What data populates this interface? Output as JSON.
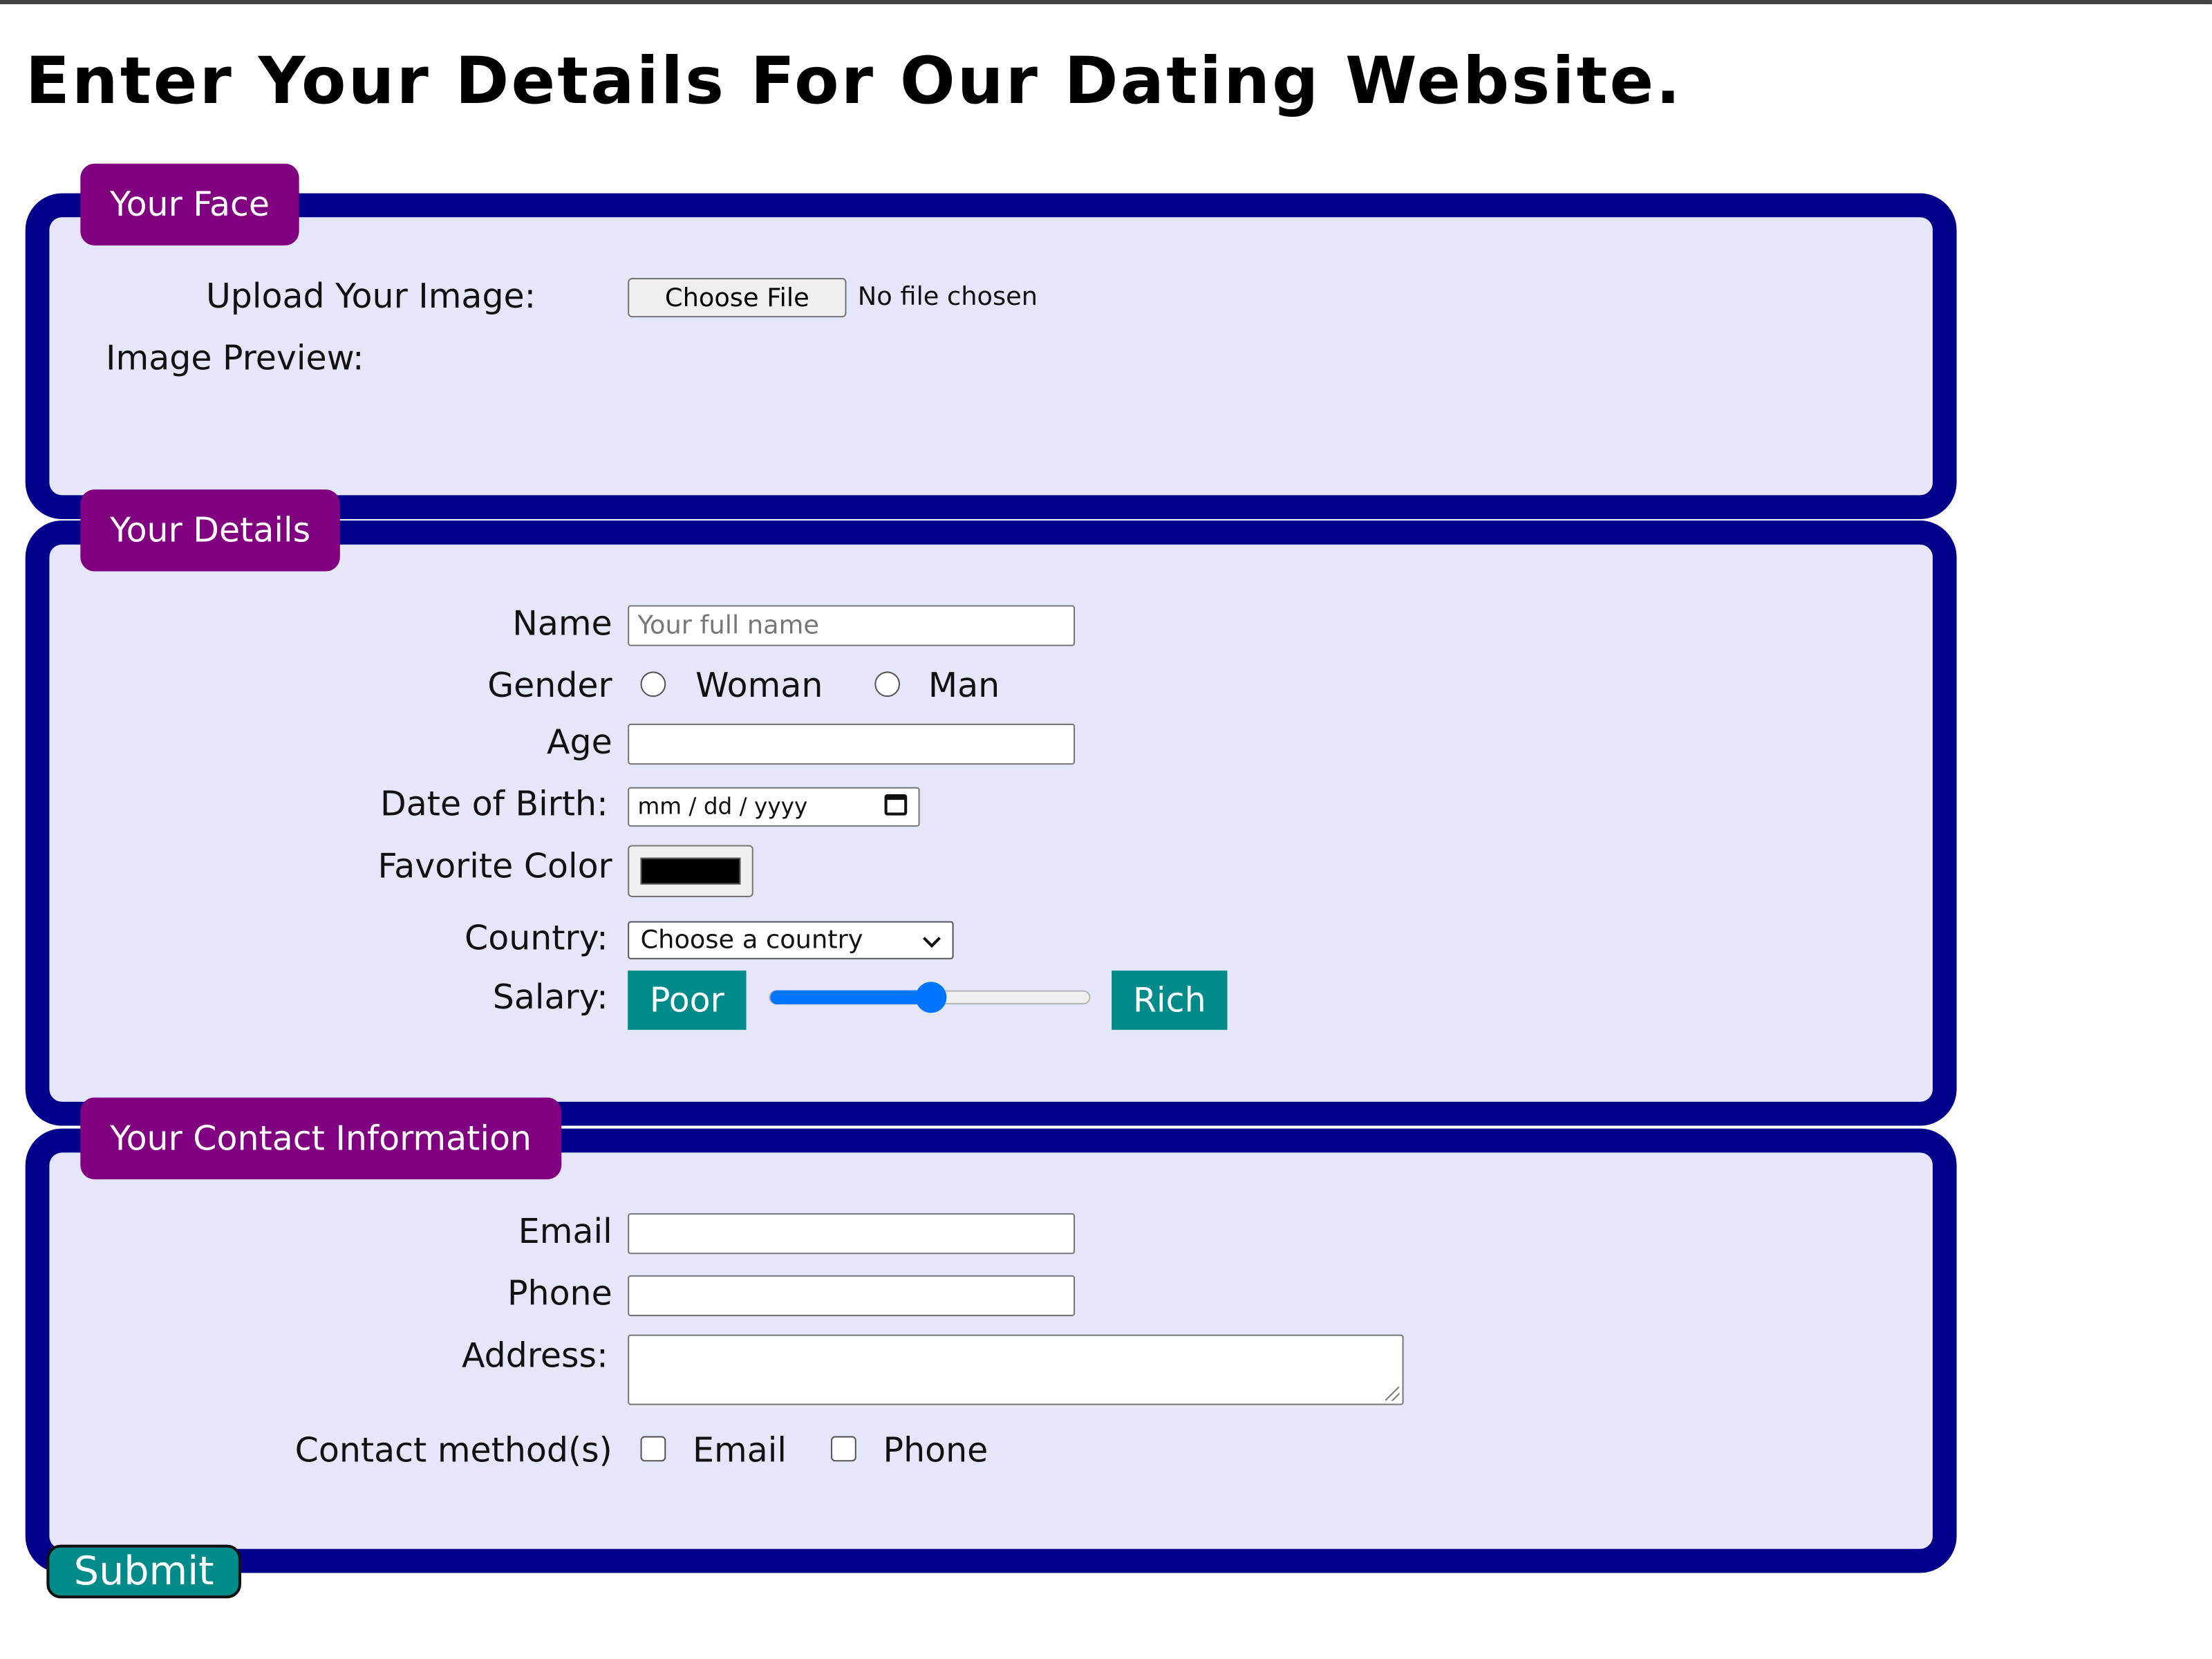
{
  "page": {
    "title": "Enter Your Details For Our Dating Website."
  },
  "face_section": {
    "legend": "Your Face",
    "upload_label": "Upload Your Image:",
    "choose_file_button": "Choose File",
    "file_status": "No file chosen",
    "preview_label": "Image Preview:"
  },
  "details_section": {
    "legend": "Your Details",
    "name_label": "Name",
    "name_placeholder": "Your full name",
    "gender_label": "Gender",
    "gender_options": [
      "Woman",
      "Man"
    ],
    "age_label": "Age",
    "dob_label": "Date of Birth:",
    "dob_placeholder": "mm / dd / yyyy",
    "color_label": "Favorite Color",
    "color_value": "#000000",
    "country_label": "Country:",
    "country_selected": "Choose a country",
    "salary_label": "Salary:",
    "salary_min_label": "Poor",
    "salary_max_label": "Rich",
    "salary_fraction": 0.5
  },
  "contact_section": {
    "legend": "Your Contact Information",
    "email_label": "Email",
    "phone_label": "Phone",
    "address_label": "Address:",
    "method_label": "Contact method(s)",
    "method_options": [
      "Email",
      "Phone"
    ]
  },
  "submit_button": "Submit",
  "colors": {
    "panel_border": "#00008b",
    "panel_bg": "#e6e6fa",
    "legend_bg": "#800080",
    "accent_teal": "#008b8b",
    "slider_blue": "#0075ff"
  }
}
